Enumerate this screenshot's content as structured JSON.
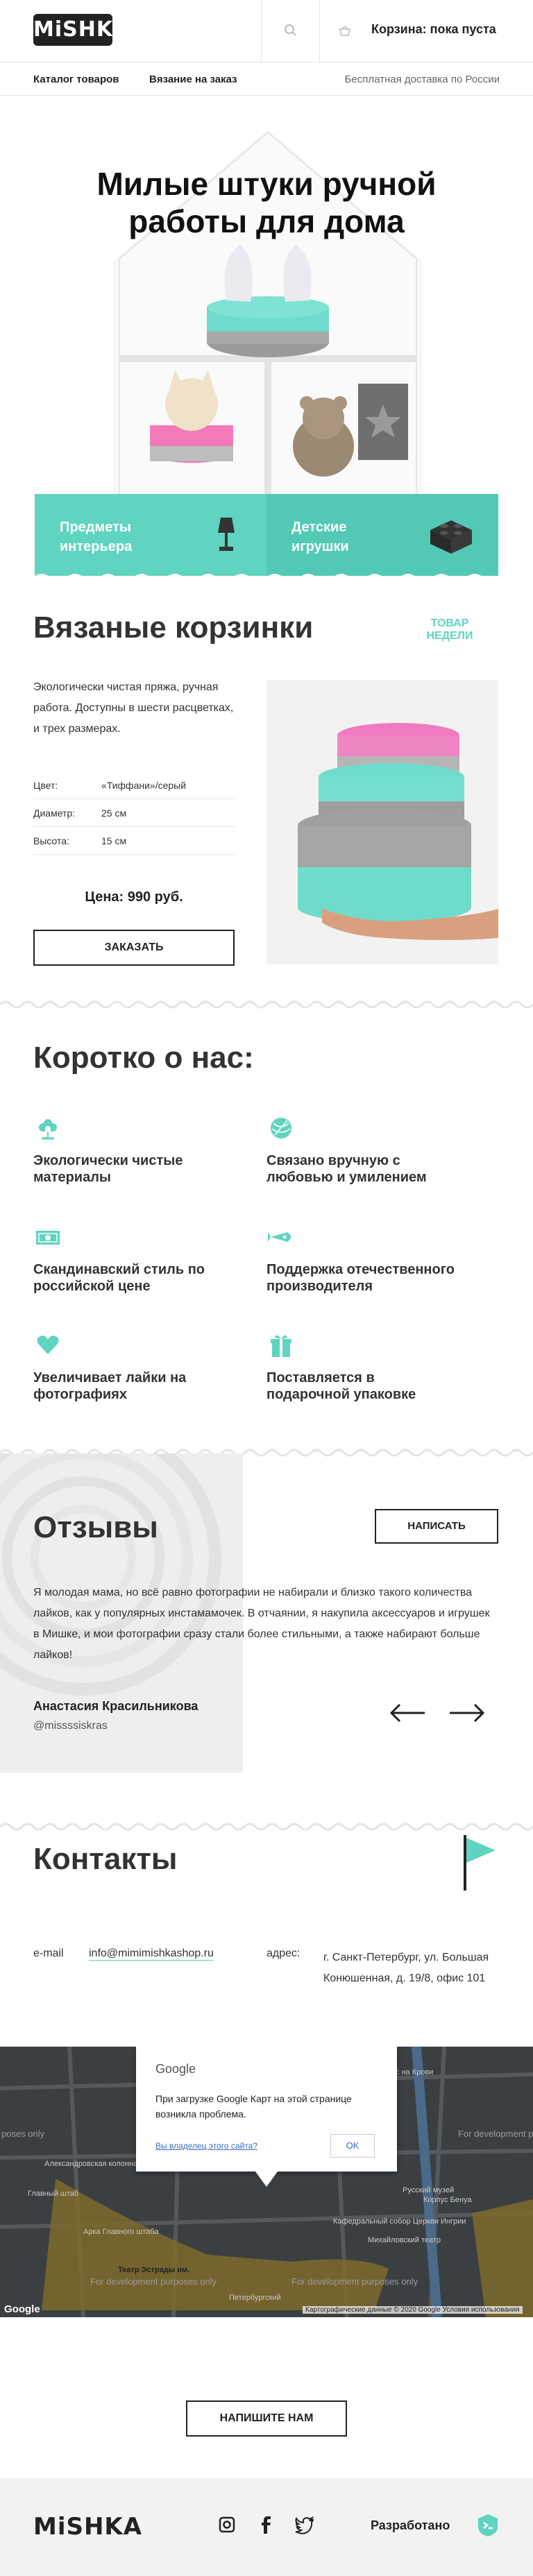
{
  "header": {
    "logo": "MiSHKA",
    "cart": "Корзина: пока пуста"
  },
  "nav": {
    "catalog": "Каталог товаров",
    "knitting": "Вязание на заказ",
    "shipping": "Бесплатная доставка по России"
  },
  "hero": {
    "title": "Милые штуки ручной работы для дома",
    "tiles": [
      {
        "label": "Предметы интерьера",
        "icon": "lamp-icon"
      },
      {
        "label": "Детские игрушки",
        "icon": "lego-brick-icon"
      }
    ]
  },
  "product": {
    "title": "Вязаные корзинки",
    "badge": "ТОВАР НЕДЕЛИ",
    "description": "Экологически чистая пряжа, ручная работа. Доступны в шести расцветках, и трех размерах.",
    "specs": [
      {
        "key": "Цвет:",
        "value": "«Тиффани»/серый"
      },
      {
        "key": "Диаметр:",
        "value": "25 см"
      },
      {
        "key": "Высота:",
        "value": "15 см"
      }
    ],
    "price": "Цена: 990 руб.",
    "order_button": "ЗАКАЗАТЬ"
  },
  "about": {
    "title": "Коротко о нас:",
    "features": [
      {
        "text": "Экологически чистые материалы",
        "icon": "flower-icon"
      },
      {
        "text": "Связано вручную с любовью и умилением",
        "icon": "yarn-ball-icon"
      },
      {
        "text": "Скандинавский стиль по российской цене",
        "icon": "banknote-icon"
      },
      {
        "text": "Поддержка отечественного производителя",
        "icon": "rocket-icon"
      },
      {
        "text": "Увеличивает лайки на фотографиях",
        "icon": "heart-icon"
      },
      {
        "text": "Поставляется в подарочной упаковке",
        "icon": "gift-icon"
      }
    ]
  },
  "reviews": {
    "title": "Отзывы",
    "write_button": "НАПИСАТЬ",
    "text": "Я молодая мама, но всё равно фотографии не набирали и близко такого количества лайков, как у популярных инстамамочек. В отчаянии, я накупила аксессуаров и игрушек в Мишке, и мои фотографии сразу стали более стильными, а также набирают больше лайков!",
    "author": "Анастасия Красильникова",
    "nick": "@missssiskras"
  },
  "contacts": {
    "title": "Контакты",
    "email_label": "e-mail",
    "email": "info@mimimishkashop.ru",
    "address_label": "адрес:",
    "address": "г. Санкт-Петербург, ул. Большая Конюшенная, д. 19/8, офис 101"
  },
  "map": {
    "dialog_brand": "Google",
    "dialog_message": "При загрузке Google Карт на этой странице возникла проблема.",
    "dialog_owner": "Вы владелец этого сайта?",
    "dialog_ok": "OK",
    "credits": "Картографические данные © 2020 Google    Условия использования",
    "google_logo": "Google",
    "dev_label": "For development purposes only",
    "labels": [
      "Александровская колонна",
      "Главный штаб",
      "Арка Главного штаба",
      "Русский музей",
      "Корпус Бенуа",
      "Кафедральный собор Церкви Ингрии",
      "Михайловский театр",
      "Театр Эстрады им.",
      "Петербургский",
      "Спас на Крови"
    ]
  },
  "write_us": "НАПИШИТЕ НАМ",
  "footer": {
    "logo": "MiSHKA",
    "developed": "Разработано",
    "social": [
      "instagram-icon",
      "facebook-icon",
      "twitter-icon"
    ]
  },
  "colors": {
    "accent": "#5fd4c0",
    "dark": "#222222",
    "text": "#333333"
  }
}
